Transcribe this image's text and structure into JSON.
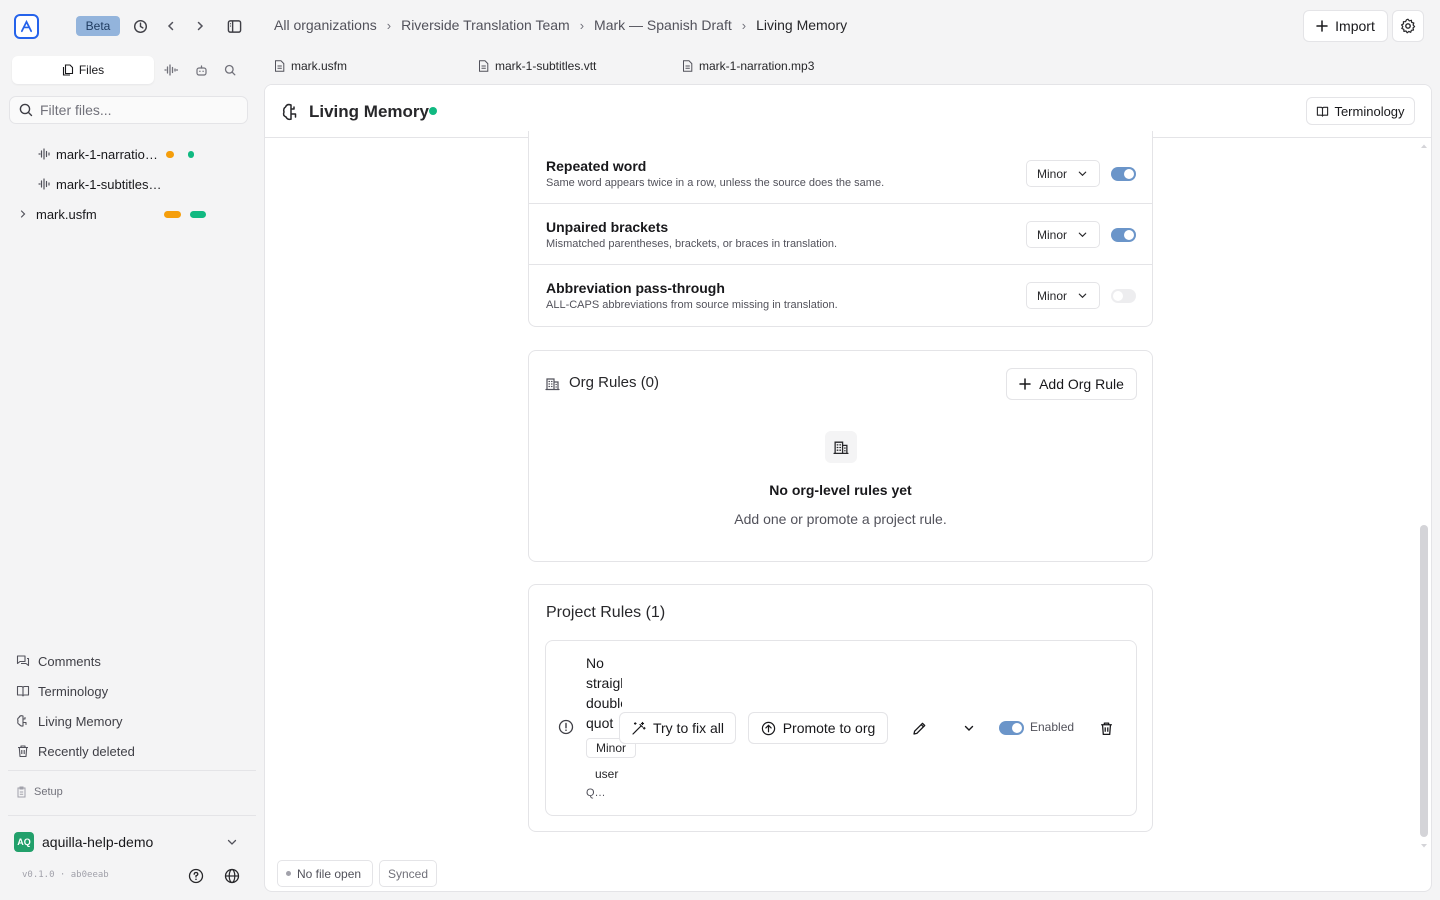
{
  "topbar": {
    "beta_label": "Beta",
    "breadcrumb": [
      "All organizations",
      "Riverside Translation Team",
      "Mark — Spanish Draft",
      "Living Memory"
    ],
    "import_label": "Import"
  },
  "doc_tabs": [
    "mark.usfm",
    "mark-1-subtitles.vtt",
    "mark-1-narration.mp3"
  ],
  "sidebar": {
    "files_tab_label": "Files",
    "filter_placeholder": "Filter files...",
    "files": [
      {
        "name": "mark-1-narratio…",
        "status_colors": [
          "#f59e0b",
          "#10b981"
        ]
      },
      {
        "name": "mark-1-subtitles…",
        "status_colors": [
          "#f4f4f5",
          "#f4f4f5"
        ]
      },
      {
        "name": "mark.usfm",
        "status_colors": [
          "#f59e0b",
          "#10b981"
        ]
      }
    ],
    "nav": [
      "Comments",
      "Terminology",
      "Living Memory",
      "Recently deleted"
    ],
    "setup_label": "Setup",
    "workspace": {
      "badge": "AQ",
      "name": "aquilla-help-demo"
    },
    "version": "v0.1.0 · ab0eeab"
  },
  "panel": {
    "title": "Living Memory",
    "status_color": "#10b981",
    "terminology_label": "Terminology"
  },
  "builtin_rules": [
    {
      "title": "Repeated word",
      "description": "Same word appears twice in a row, unless the source does the same.",
      "severity": "Minor",
      "enabled": true
    },
    {
      "title": "Unpaired brackets",
      "description": "Mismatched parentheses, brackets, or braces in translation.",
      "severity": "Minor",
      "enabled": true
    },
    {
      "title": "Abbreviation pass-through",
      "description": "ALL-CAPS abbreviations from source missing in translation.",
      "severity": "Minor",
      "enabled": false
    }
  ],
  "org_rules": {
    "heading": "Org Rules (0)",
    "add_label": "Add Org Rule",
    "empty_title": "No org-level rules yet",
    "empty_subtitle": "Add one or promote a project rule."
  },
  "project_rules": {
    "heading": "Project Rules (1)",
    "rule": {
      "title_lines": [
        "No",
        "straight",
        "double",
        "quot"
      ],
      "severity": "Minor",
      "source_badge": "user",
      "trailing_text": "Q…",
      "fix_label": "Try to fix all",
      "promote_label": "Promote to org",
      "enabled_label": "Enabled",
      "enabled": true
    }
  },
  "statusbar": {
    "file_label": "No file open",
    "sync_label": "Synced"
  },
  "colors": {
    "accent": "#2563eb",
    "toggle_on": "#6b95c9",
    "warning": "#f59e0b",
    "success": "#10b981"
  }
}
